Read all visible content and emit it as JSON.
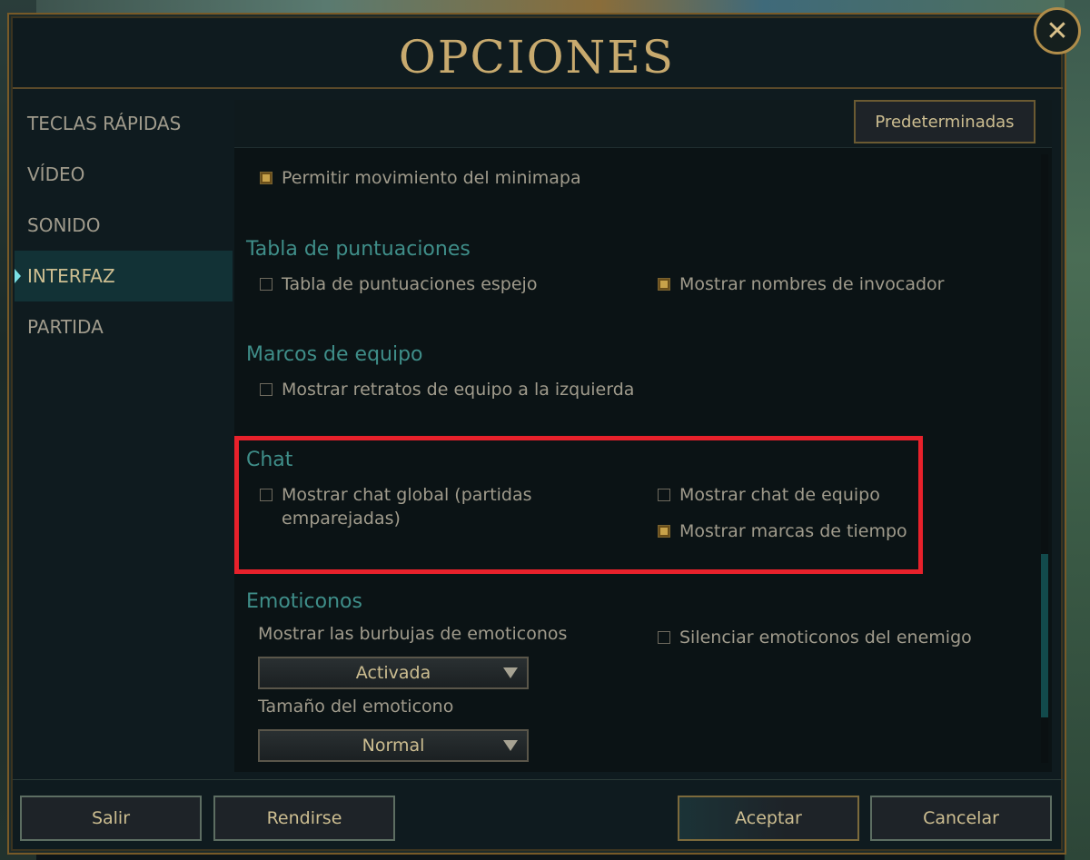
{
  "window": {
    "title": "OPCIONES",
    "close_symbol": "✕"
  },
  "sidebar": {
    "items": [
      {
        "label": "TECLAS RÁPIDAS"
      },
      {
        "label": "VÍDEO"
      },
      {
        "label": "SONIDO"
      },
      {
        "label": "INTERFAZ",
        "active": true
      },
      {
        "label": "PARTIDA"
      }
    ]
  },
  "panel": {
    "defaults_button": "Predeterminadas",
    "minimap_option": {
      "label": "Permitir movimiento del minimapa",
      "checked": true
    },
    "scoreboard": {
      "title": "Tabla de puntuaciones",
      "options": [
        {
          "label": "Tabla de puntuaciones espejo",
          "checked": false
        },
        {
          "label": "Mostrar nombres de invocador",
          "checked": true
        }
      ]
    },
    "team_frames": {
      "title": "Marcos de equipo",
      "options": [
        {
          "label": "Mostrar retratos de equipo a la izquierda",
          "checked": false
        }
      ]
    },
    "chat": {
      "title": "Chat",
      "options": [
        {
          "label": "Mostrar chat global (partidas emparejadas)",
          "checked": false
        },
        {
          "label": "Mostrar chat de equipo",
          "checked": false
        },
        {
          "label": "Mostrar marcas de tiempo",
          "checked": true
        }
      ]
    },
    "emotes": {
      "title": "Emoticonos",
      "bubbles_label": "Mostrar las burbujas de emoticonos",
      "bubbles_value": "Activada",
      "size_label": "Tamaño del emoticono",
      "size_value": "Normal",
      "mute_option": {
        "label": "Silenciar emoticonos del enemigo",
        "checked": false
      }
    }
  },
  "footer": {
    "exit": "Salir",
    "surrender": "Rendirse",
    "accept": "Aceptar",
    "cancel": "Cancelar"
  },
  "colors": {
    "gold_accent": "#c8aa6e",
    "section_teal": "#3f8e89",
    "highlight_red": "#e8212b"
  }
}
